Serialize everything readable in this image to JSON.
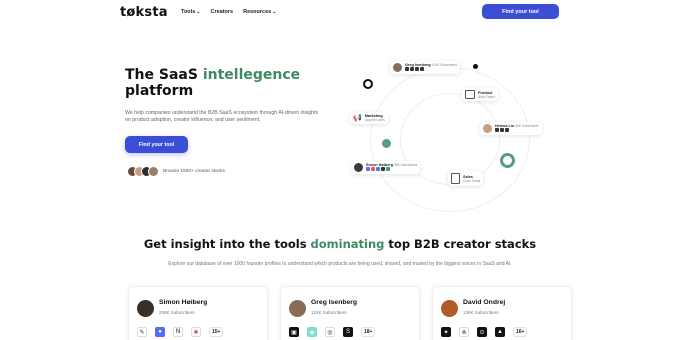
{
  "nav": {
    "logo": "tøksta",
    "links": [
      {
        "label": "Tools",
        "dropdown": true
      },
      {
        "label": "Creators",
        "dropdown": false
      },
      {
        "label": "Resources",
        "dropdown": true
      }
    ],
    "cta": "Find your tool"
  },
  "hero": {
    "title_pre": "The SaaS ",
    "title_accent": "intellegence",
    "title_post": " platform",
    "description": "We help companies understand the B2B SaaS ecosystem through AI-driven insights on product adoption, creator influence, and user sentiment.",
    "cta": "Find your tool",
    "avatars_text": "Browse 1500+ creator stacks"
  },
  "orbit": {
    "greg_card": {
      "name": "Greg Isenberg",
      "subscribers": "124K Subscribers"
    },
    "product_card": {
      "title": "Product",
      "subtitle": "Build Faster"
    },
    "marketing_card": {
      "title": "Marketing",
      "subtitle": "Acquire Users"
    },
    "helena_card": {
      "name": "Helena Liu",
      "subscribers": "55K Subscribers"
    },
    "simon_card": {
      "name": "Simon Høiberg",
      "subscribers": "96K Subscribers"
    },
    "sales_card": {
      "title": "Sales",
      "subtitle": "Close Deals"
    }
  },
  "section": {
    "title_pre": "Get insight into the tools ",
    "title_accent": "dominating",
    "title_post": " top B2B creator stacks",
    "description": "Explore our database of over 1000 founder profiles to understand which products are being used, shared, and trusted by the biggest voices in SaaS and AI."
  },
  "creators": [
    {
      "name": "Simon Høiberg",
      "subscribers": "206K Subscribers",
      "more": "15+"
    },
    {
      "name": "Greg Isenberg",
      "subscribers": "124K Subscribers",
      "more": "18+"
    },
    {
      "name": "David Ondrej",
      "subscribers": "136K Subscribers",
      "more": "16+"
    }
  ],
  "colors": {
    "accent_green": "#3f8a65",
    "brand_blue": "#3a4fd6"
  }
}
